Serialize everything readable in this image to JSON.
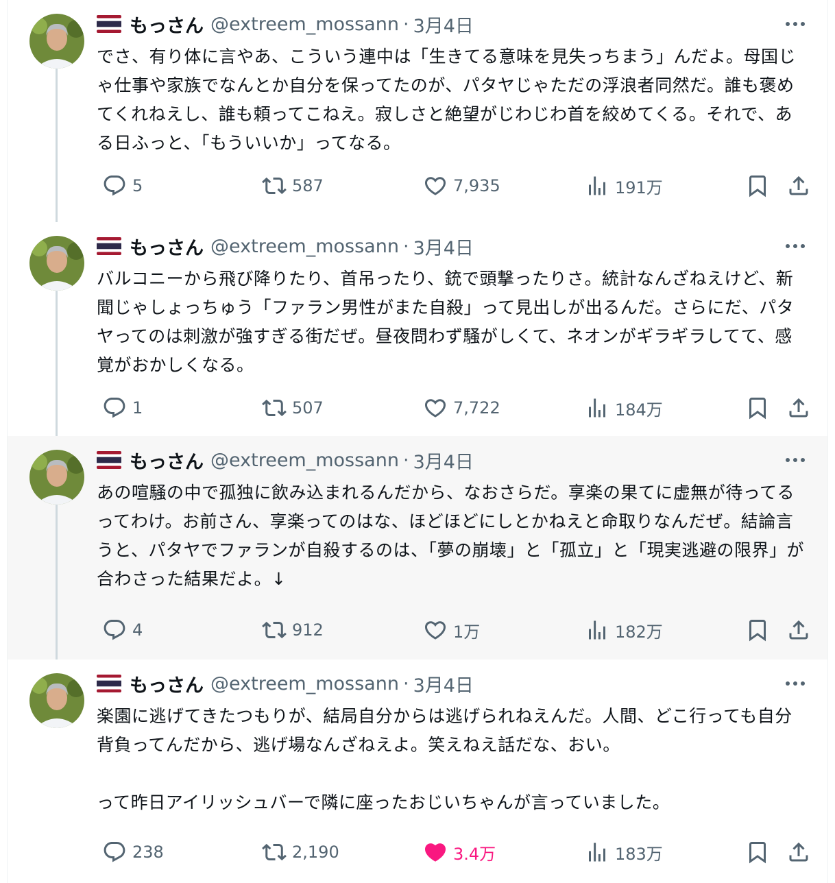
{
  "tweets": [
    {
      "name": "もっさん",
      "handle": "@extreem_mossann",
      "dot": "·",
      "date": "3月4日",
      "text": "でさ、有り体に言やあ、こういう連中は「生きてる意味を見失っちまう」んだよ。母国じゃ仕事や家族でなんとか自分を保ってたのが、パタヤじゃただの浮浪者同然だ。誰も褒めてくれねえし、誰も頼ってこねえ。寂しさと絶望がじわじわ首を絞めてくる。それで、ある日ふっと、「もういいか」ってなる。",
      "replies": "5",
      "retweets": "587",
      "likes": "7,935",
      "views": "191万",
      "liked": false
    },
    {
      "name": "もっさん",
      "handle": "@extreem_mossann",
      "dot": "·",
      "date": "3月4日",
      "text": "バルコニーから飛び降りたり、首吊ったり、銃で頭撃ったりさ。統計なんざねえけど、新聞じゃしょっちゅう「ファラン男性がまた自殺」って見出しが出るんだ。さらにだ、パタヤってのは刺激が強すぎる街だぜ。昼夜問わず騒がしくて、ネオンがギラギラしてて、感覚がおかしくなる。",
      "replies": "1",
      "retweets": "507",
      "likes": "7,722",
      "views": "184万",
      "liked": false
    },
    {
      "name": "もっさん",
      "handle": "@extreem_mossann",
      "dot": "·",
      "date": "3月4日",
      "text": "あの喧騒の中で孤独に飲み込まれるんだから、なおさらだ。享楽の果てに虚無が待ってるってわけ。お前さん、享楽ってのはな、ほどほどにしとかねえと命取りなんだぜ。結論言うと、パタヤでファランが自殺するのは、「夢の崩壊」と「孤立」と「現実逃避の限界」が合わさった結果だよ。↓",
      "replies": "4",
      "retweets": "912",
      "likes": "1万",
      "views": "182万",
      "liked": false
    },
    {
      "name": "もっさん",
      "handle": "@extreem_mossann",
      "dot": "·",
      "date": "3月4日",
      "text": "楽園に逃げてきたつもりが、結局自分からは逃げられねえんだ。人間、どこ行っても自分背負ってんだから、逃げ場なんざねえよ。笑えねえ話だな、おい。\n\nって昨日アイリッシュバーで隣に座ったおじいちゃんが言っていました。",
      "replies": "238",
      "retweets": "2,190",
      "likes": "3.4万",
      "views": "183万",
      "liked": true
    }
  ],
  "colors": {
    "text": "#0f1419",
    "secondary": "#536471",
    "like": "#f91880",
    "thread_line": "#cfd9de",
    "highlight_bg": "#f7f7f7"
  },
  "icons": [
    "thailand-flag-icon",
    "more-icon",
    "reply-icon",
    "retweet-icon",
    "like-icon",
    "views-icon",
    "bookmark-icon",
    "share-icon"
  ]
}
